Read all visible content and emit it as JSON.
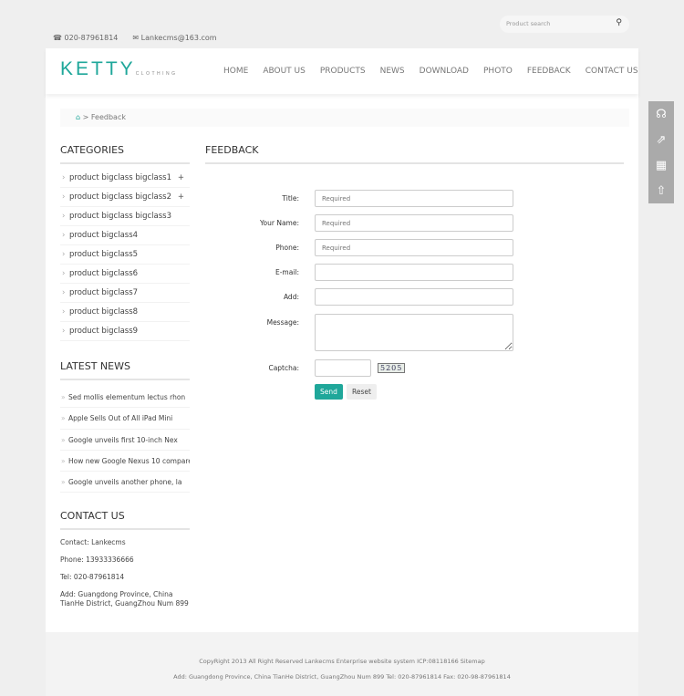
{
  "topbar": {
    "phone": "020-87961814",
    "email": "Lankecms@163.com",
    "search_placeholder": "Product search"
  },
  "logo": {
    "main": "KETTY",
    "sub": "CLOTHING"
  },
  "nav": [
    "HOME",
    "ABOUT US",
    "PRODUCTS",
    "NEWS",
    "DOWNLOAD",
    "PHOTO",
    "FEEDBACK",
    "CONTACT US"
  ],
  "breadcrumb": {
    "current": "Feedback",
    "sep": ">"
  },
  "sidebar": {
    "categories_title": "CATEGORIES",
    "categories": [
      {
        "label": "product bigclass bigclass1",
        "plus": "+"
      },
      {
        "label": "product bigclass bigclass2",
        "plus": "+"
      },
      {
        "label": "product bigclass bigclass3"
      },
      {
        "label": "product bigclass4"
      },
      {
        "label": "product bigclass5"
      },
      {
        "label": "product bigclass6"
      },
      {
        "label": "product bigclass7"
      },
      {
        "label": "product bigclass8"
      },
      {
        "label": "product bigclass9"
      }
    ],
    "news_title": "LATEST NEWS",
    "news": [
      "Sed mollis elementum lectus rhon",
      "Apple Sells Out of All iPad Mini",
      "Google unveils first 10-inch Nex",
      "How new Google Nexus 10 compares",
      "Google unveils another phone, la"
    ],
    "contact_title": "CONTACT US",
    "contact": [
      "Contact: Lankecms",
      "Phone: 13933336666",
      "Tel: 020-87961814",
      "Add: Guangdong Province, China TianHe District, GuangZhou Num 899"
    ]
  },
  "main": {
    "title": "FEEDBACK",
    "fields": [
      {
        "label": "Title:",
        "placeholder": "Required"
      },
      {
        "label": "Your Name:",
        "placeholder": "Required"
      },
      {
        "label": "Phone:",
        "placeholder": "Required"
      },
      {
        "label": "E-mail:",
        "placeholder": ""
      },
      {
        "label": "Add:",
        "placeholder": ""
      }
    ],
    "message_label": "Message:",
    "captcha_label": "Captcha:",
    "captcha_code": "5205",
    "send": "Send",
    "reset": "Reset"
  },
  "footer": {
    "line1": "CopyRight 2013 All Right Reserved Lankecms Enterprise website system ICP:08118166 Sitemap",
    "line2": "Add: Guangdong Province, China TianHe District, GuangZhou Num 899  Tel: 020-87961814  Fax: 020-98-87961814"
  },
  "accent": "#1fa79a"
}
